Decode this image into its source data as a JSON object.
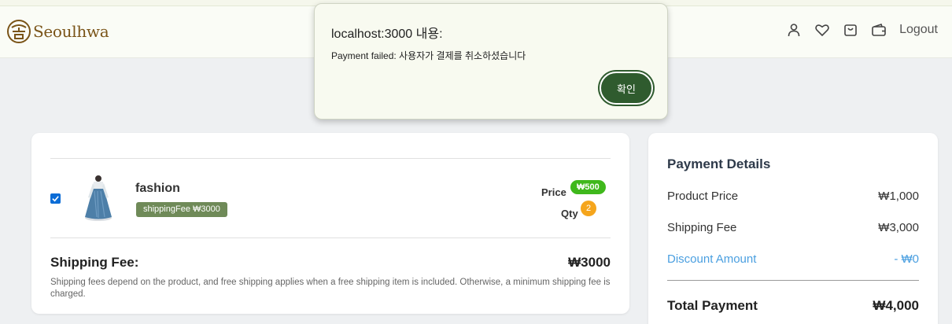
{
  "header": {
    "logo_text": "Seoulhwa",
    "nav_icons": [
      "user-icon",
      "heart-icon",
      "bag-icon",
      "wallet-icon"
    ],
    "logout_label": "Logout"
  },
  "cart": {
    "item": {
      "checked": true,
      "name": "fashion",
      "shipping_badge": "shippingFee ₩3000",
      "price_label": "Price",
      "price_value": "₩500",
      "qty_label": "Qty",
      "qty_value": "2"
    },
    "shipping_fee_label": "Shipping Fee:",
    "shipping_fee_value": "₩3000",
    "shipping_note": "Shipping fees depend on the product, and free shipping applies when a free shipping item is included. Otherwise, a minimum shipping fee is charged."
  },
  "payment": {
    "title": "Payment Details",
    "product_price_label": "Product Price",
    "product_price_value": "₩1,000",
    "shipping_fee_label": "Shipping Fee",
    "shipping_fee_value": "₩3,000",
    "discount_label": "Discount Amount",
    "discount_value": "- ₩0",
    "total_label": "Total Payment",
    "total_value": "₩4,000"
  },
  "dialog": {
    "title": "localhost:3000 내용:",
    "message": "Payment failed: 사용자가 결제를 취소하셨습니다",
    "ok_label": "확인"
  },
  "colors": {
    "brand": "#7a5418",
    "badge_green": "#6f8a58",
    "price_pill": "#3fb81c",
    "qty_badge": "#f5a51c",
    "discount_blue": "#4a9fe0",
    "dialog_button": "#2f5b2e"
  }
}
